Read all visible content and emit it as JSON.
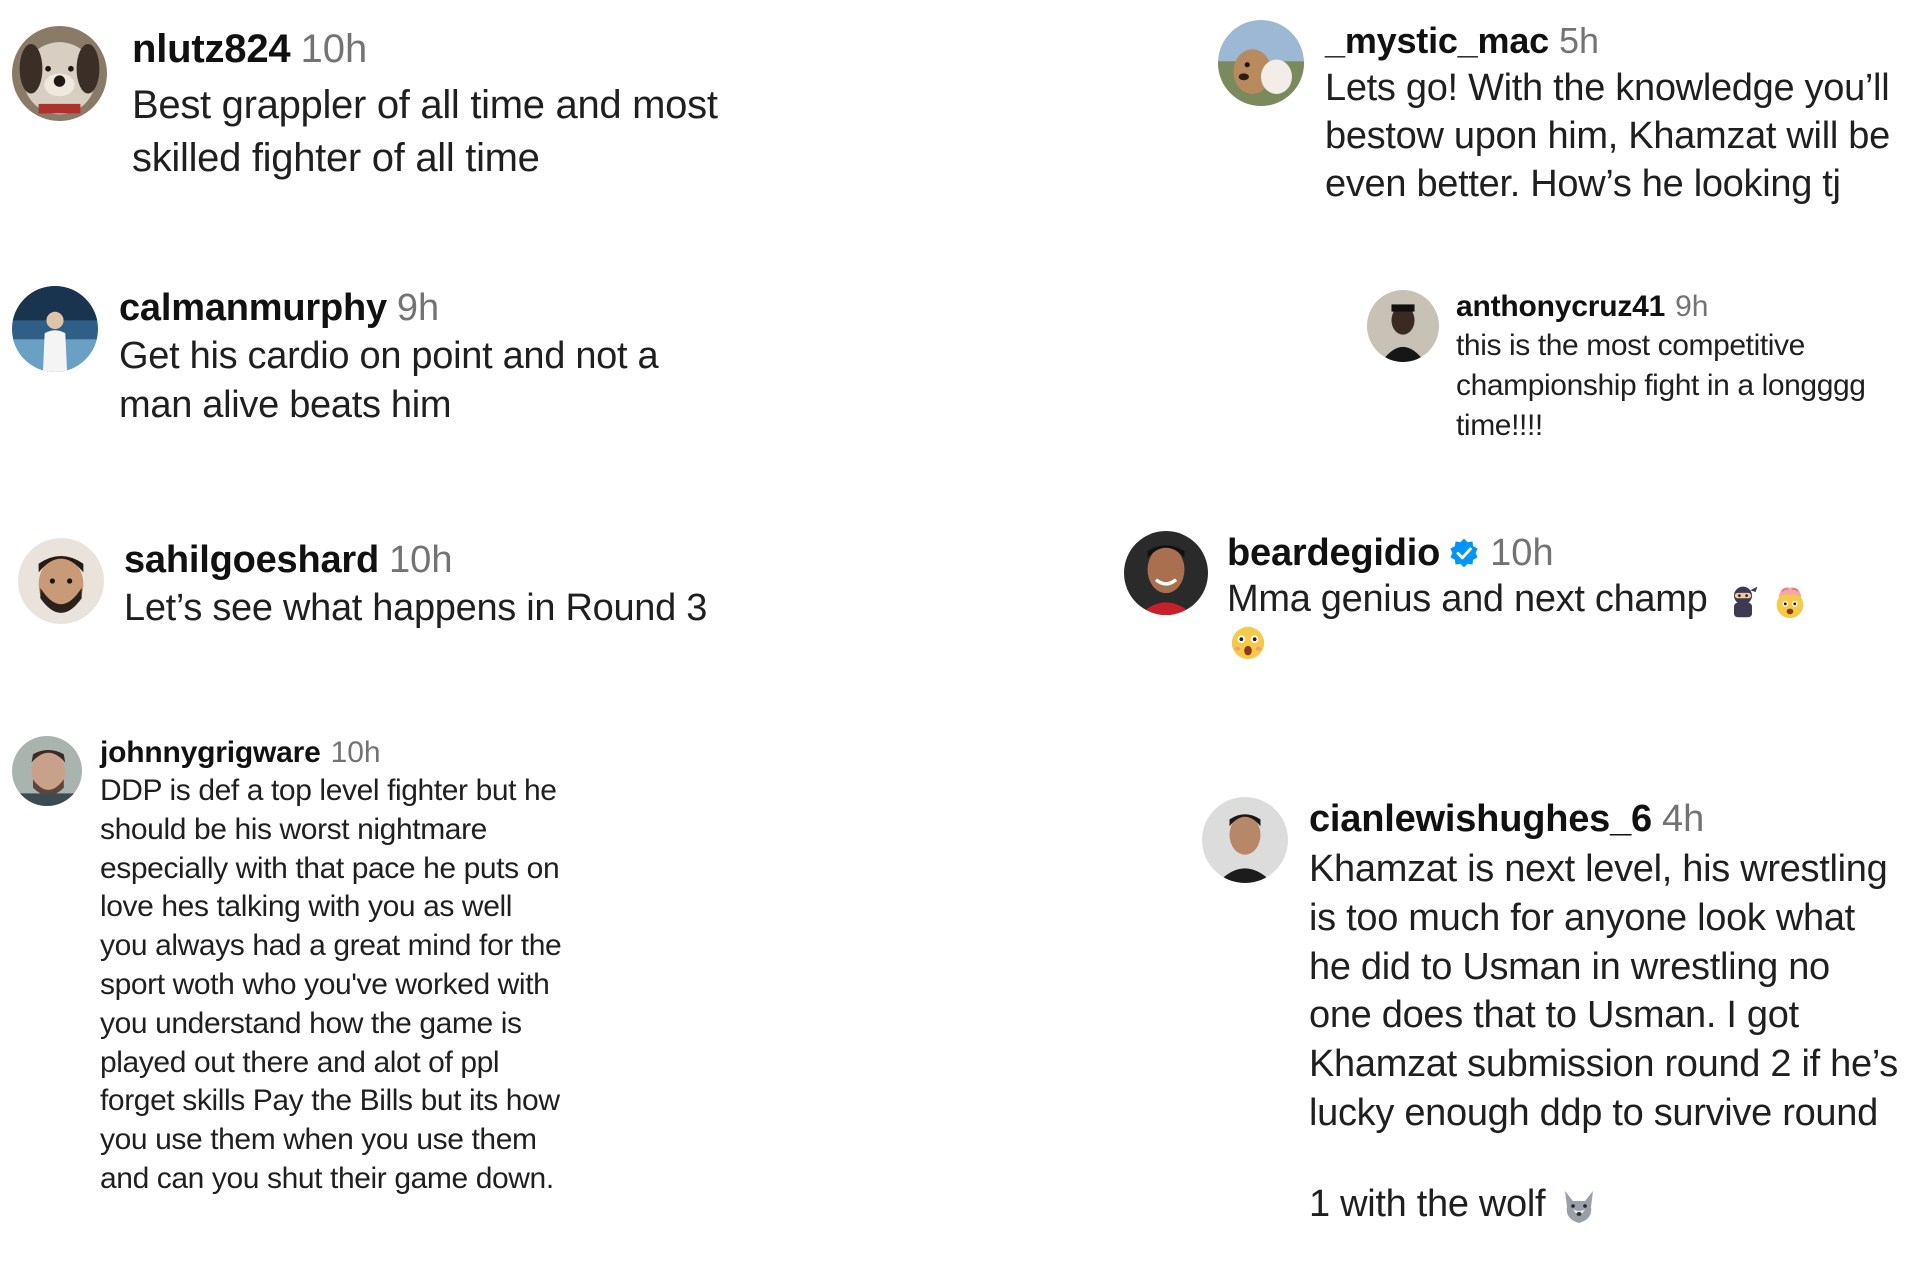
{
  "comments": [
    {
      "username": "nlutz824",
      "time": "10h",
      "text": "Best grappler of all time and most\nskilled fighter of all time",
      "avatar_icon": "dog-plush-avatar-icon"
    },
    {
      "username": "calmanmurphy",
      "time": "9h",
      "text": "Get his cardio on point and not a\nman alive beats him",
      "avatar_icon": "person-stadium-avatar-icon"
    },
    {
      "username": "sahilgoeshard",
      "time": "10h",
      "text": "Let’s see what happens in Round 3",
      "avatar_icon": "bearded-man-avatar-icon"
    },
    {
      "username": "johnnygrigware",
      "time": "10h",
      "text": "DDP is def a top level fighter but he\nshould be his worst nightmare\nespecially with that pace he puts on\nlove hes talking with you as well\nyou always had a great mind for the\nsport woth who you've worked with\nyou understand how the game is\nplayed out there and alot of ppl\nforget skills Pay the Bills but its how\nyou use them when you use them\nand can you shut their game down.",
      "avatar_icon": "man-selfie-avatar-icon"
    },
    {
      "username": "_mystic_mac",
      "time": "5h",
      "text": "Lets go! With the knowledge you’ll\nbestow upon him, Khamzat will be\neven better. How’s he looking tj",
      "avatar_icon": "dog-outdoor-avatar-icon"
    },
    {
      "username": "anthonycruz41",
      "time": "9h",
      "text": "this is the most competitive\nchampionship fight in a longggg\ntime!!!!",
      "avatar_icon": "man-dark-avatar-icon"
    },
    {
      "username": "beardegidio",
      "time": "10h",
      "text": "Mma genius and next champ",
      "verified": true,
      "emojis": [
        "ninja-emoji-icon",
        "mind-blown-emoji-icon",
        "shocked-face-emoji-icon"
      ],
      "avatar_icon": "smiling-man-avatar-icon"
    },
    {
      "username": "cianlewishughes_6",
      "time": "4h",
      "text": "Khamzat is next level, his wrestling\nis too much for anyone look what\nhe did to Usman in wrestling no\none does that to Usman. I got\nKhamzat submission round 2 if he’s\nlucky enough ddp to survive round\n1 with the wolf",
      "emojis": [
        "wolf-emoji-icon"
      ],
      "avatar_icon": "man-portrait-avatar-icon"
    }
  ],
  "colors": {
    "username": "#111111",
    "timestamp": "#737373",
    "text": "#1f1f1f",
    "verified_badge": "#0095f6"
  }
}
